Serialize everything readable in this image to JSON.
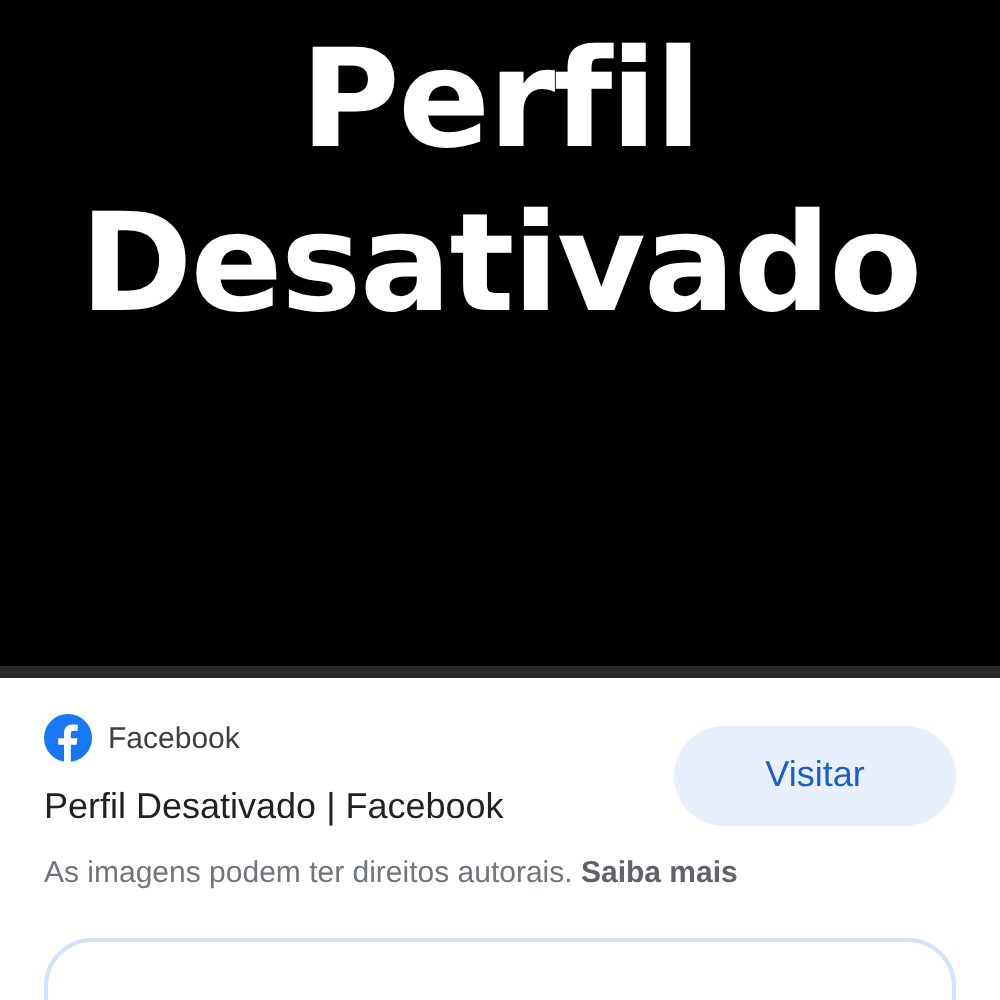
{
  "image": {
    "lines": [
      "Perfil",
      "Desativado"
    ]
  },
  "source": {
    "name": "Facebook"
  },
  "title": "Perfil Desativado | Facebook",
  "visit_button": "Visitar",
  "notice": {
    "text": "As imagens podem ter direitos autorais.",
    "link": "Saiba mais"
  }
}
